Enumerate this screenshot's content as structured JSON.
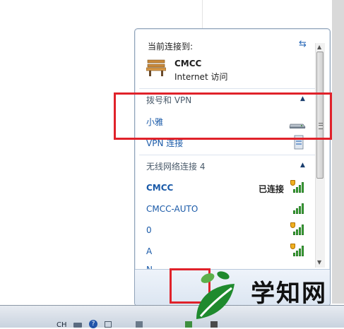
{
  "connected_to_label": "当前连接到:",
  "current_network": {
    "name": "CMCC",
    "access": "Internet 访问",
    "icon": "bench-network-icon"
  },
  "sections": {
    "dialup": {
      "header": "拨号和 VPN",
      "items": [
        "小雅",
        "VPN 连接"
      ]
    },
    "wireless": {
      "header": "无线网络连接 4",
      "items": [
        {
          "name": "CMCC",
          "status": "已连接"
        },
        {
          "name": "CMCC-AUTO",
          "status": ""
        },
        {
          "name": "0",
          "status": ""
        },
        {
          "name": "A",
          "status": ""
        },
        {
          "name": "N...",
          "status": ""
        }
      ]
    }
  },
  "taskbar": {
    "lang": "CH"
  },
  "watermark": {
    "text": "学知网"
  },
  "colors": {
    "link": "#1a5aa8",
    "highlight_box": "#e0222a",
    "signal": "#3fae3a"
  }
}
